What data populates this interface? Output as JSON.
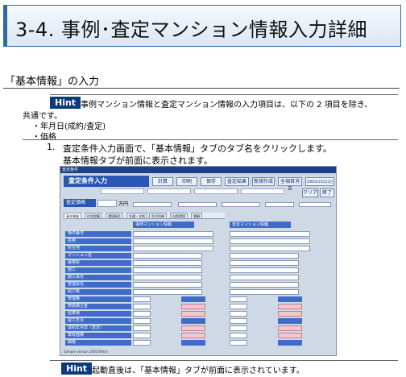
{
  "title": "3-4. 事例･査定マンション情報入力詳細",
  "section_title": "「基本情報」の入力",
  "hint_label": "Hint",
  "hint1_text": "事例マンション情報と査定マンション情報の入力項目は、以下の 2 項目を除き、",
  "hint1_cont": "共通です。",
  "bullets": [
    "・年月日(成約/査定)",
    "・価格"
  ],
  "step_number": "1.",
  "step_text": "査定条件入力画面で、「基本情報」タブのタブ名をクリックします。",
  "step_text2": "基本情報タブが前面に表示されます。",
  "app": {
    "window_title": "査定条件",
    "header": "査定条件入力",
    "buttons": [
      "計算",
      "印刷",
      "保存",
      "査定結果",
      "新規作成",
      "全項目消去",
      "2005年10月13日",
      "クリア",
      "終了"
    ],
    "price_label": "査定価格",
    "price_unit": "万円",
    "tabs": [
      "基本情報",
      "住宅設備",
      "環境衛生",
      "交通・立地",
      "生活利便",
      "自然環境",
      "景観"
    ],
    "left_panel": "事例マンション情報",
    "right_panel": "査定マンション情報",
    "rows": [
      "物件番号",
      "名称",
      "所在地",
      "マンション名",
      "最寄駅",
      "施工",
      "施工会社",
      "管理会社",
      "総戸数",
      "管理費",
      "修繕積立金",
      "駐車場",
      "竣工年月",
      "成約年月日（査定）",
      "専有面積",
      "価格"
    ],
    "status": "Sample version 2005/09/xx"
  },
  "hint2_text": "起動直後は、「基本情報」タブが前面に表示されています。"
}
